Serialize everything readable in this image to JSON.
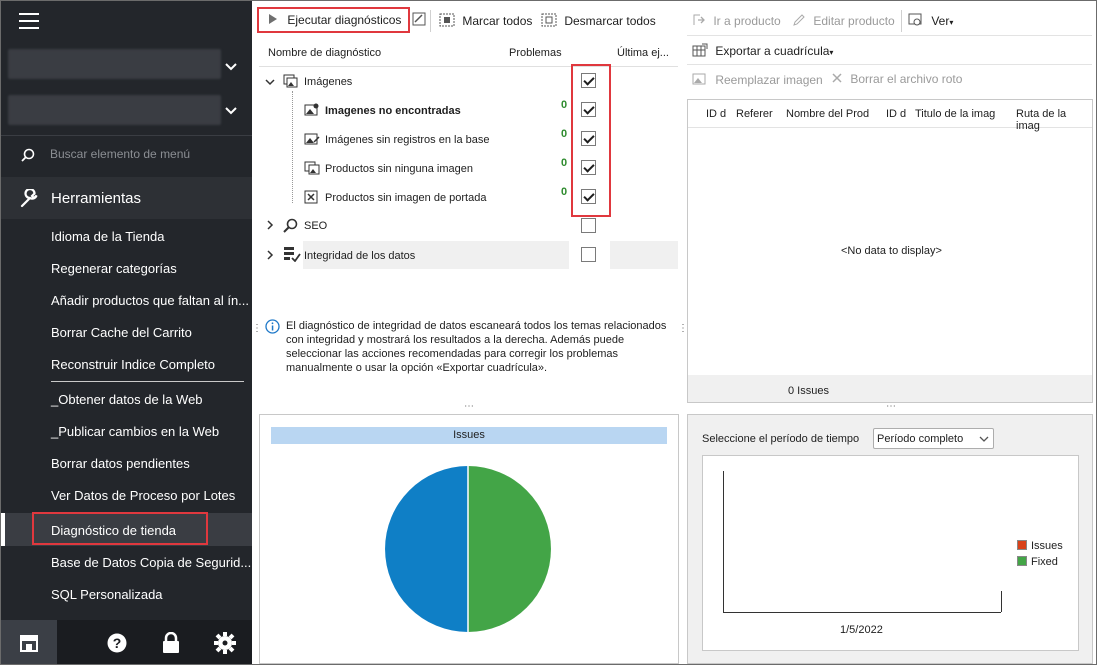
{
  "sidebar": {
    "search_placeholder": "Buscar elemento de menú",
    "section_title": "Herramientas",
    "items": [
      {
        "label": "Idioma de la Tienda"
      },
      {
        "label": "Regenerar categorías"
      },
      {
        "label": "Añadir productos que faltan al ín..."
      },
      {
        "label": "Borrar Cache del Carrito"
      },
      {
        "label": "Reconstruir Indice Completo"
      },
      {
        "label": "_Obtener datos de la Web"
      },
      {
        "label": "_Publicar cambios en la Web"
      },
      {
        "label": "Borrar datos pendientes"
      },
      {
        "label": "Ver Datos de Proceso por Lotes"
      },
      {
        "label": "Diagnóstico de tienda"
      },
      {
        "label": "Base de Datos Copia de Segurid..."
      },
      {
        "label": "SQL Personalizada"
      }
    ]
  },
  "toolbar": {
    "run": "Ejecutar diagnósticos",
    "check_all": "Marcar todos",
    "uncheck_all": "Desmarcar todos"
  },
  "grid": {
    "col_name": "Nombre de diagnóstico",
    "col_problems": "Problemas",
    "col_last": "Última ej...",
    "groups": [
      {
        "label": "Imágenes"
      },
      {
        "label": "SEO"
      },
      {
        "label": "Integridad de los datos"
      }
    ],
    "children": [
      {
        "label": "Imagenes no encontradas",
        "count": "0"
      },
      {
        "label": "Imágenes sin registros en la base",
        "count": "0"
      },
      {
        "label": "Productos sin ninguna imagen",
        "count": "0"
      },
      {
        "label": "Productos sin imagen de portada",
        "count": "0"
      }
    ]
  },
  "info_text": "El diagnóstico de integridad de datos escaneará todos los temas relacionados con integridad y mostrará los resultados a la derecha. Además puede seleccionar las acciones recomendadas para corregir los problemas manualmente o usar la opción «Exportar cuadrícula».",
  "right_toolbar": {
    "goto_product": "Ir a producto",
    "edit_product": "Editar producto",
    "view": "Ver",
    "export_grid": "Exportar a cuadrícula",
    "replace_image": "Reemplazar imagen",
    "delete_broken": "Borrar el archivo roto"
  },
  "results_grid": {
    "columns": [
      "ID d",
      "Referer",
      "Nombre del Prod",
      "ID d",
      "Titulo de la imag",
      "Ruta de la imag"
    ],
    "empty_text": "<No data to display>",
    "footer": "0 Issues"
  },
  "pie_chart": {
    "title": "Issues",
    "colors": {
      "issues": "#0f7fc6",
      "fixed": "#43a547"
    }
  },
  "period": {
    "label": "Seleccione el período de tiempo",
    "value": "Período completo"
  },
  "line_chart": {
    "x_tick": "1/5/2022",
    "legend": [
      {
        "name": "Issues",
        "color": "#d9421a"
      },
      {
        "name": "Fixed",
        "color": "#43a547"
      }
    ]
  }
}
